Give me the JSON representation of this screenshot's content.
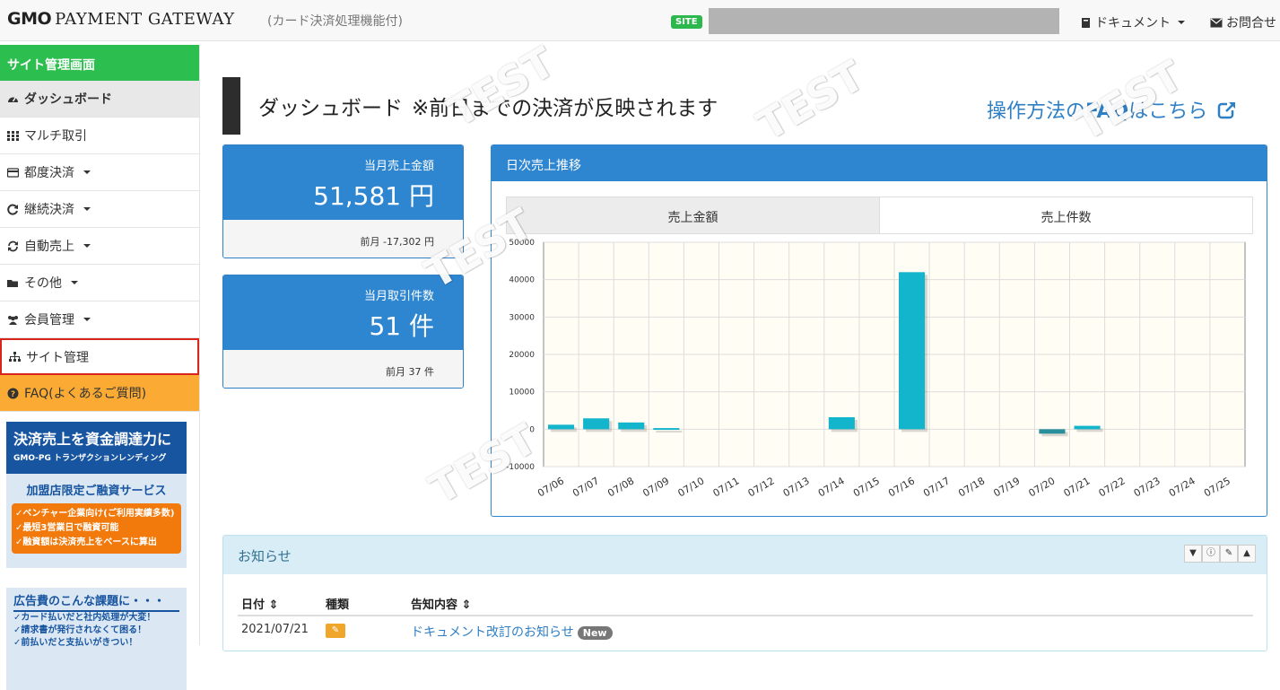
{
  "header": {
    "logo_gmo": "GMO",
    "logo_pg": "PAYMENT GATEWAY",
    "subtitle": "(カード決済処理機能付)",
    "site_badge": "SITE",
    "doc_label": "ドキュメント",
    "contact_label": "お問合せ"
  },
  "sidebar": {
    "title": "サイト管理画面",
    "items": [
      {
        "label": "ダッシュボード",
        "icon": "dashboard-icon"
      },
      {
        "label": "マルチ取引",
        "icon": "grid-icon"
      },
      {
        "label": "都度決済",
        "icon": "card-icon"
      },
      {
        "label": "継続決済",
        "icon": "repeat-icon"
      },
      {
        "label": "自動売上",
        "icon": "refresh-icon"
      },
      {
        "label": "その他",
        "icon": "folder-icon"
      },
      {
        "label": "会員管理",
        "icon": "users-icon"
      },
      {
        "label": "サイト管理",
        "icon": "sitemap-icon"
      },
      {
        "label": "FAQ(よくあるご質問)",
        "icon": "question-icon"
      }
    ],
    "banner1": {
      "title": "決済売上を資金調達力に",
      "subtitle": "GMO-PG トランザクションレンディング",
      "headline": "加盟店限定ご融資サービス",
      "points": [
        "✓ベンチャー企業向け(ご利用実績多数)",
        "✓最短3営業日で融資可能",
        "✓融資額は決済売上をベースに算出"
      ]
    },
    "banner2": {
      "title": "広告費のこんな課題に・・・",
      "points": [
        "✓カード払いだと社内処理が大変！",
        "✓請求書が発行されなくて困る！",
        "✓前払いだと支払いがきつい！"
      ]
    }
  },
  "main": {
    "title": "ダッシュボード",
    "title_note": "※前日までの決済が反映されます",
    "faq_link_pre": "操作方法の",
    "faq_link_bold": "FAQ",
    "faq_link_post": "はこちら",
    "sales": {
      "label": "当月売上金額",
      "value": "51,581 円",
      "prev": "前月 -17,302 円"
    },
    "count": {
      "label": "当月取引件数",
      "value": "51 件",
      "prev": "前月 37 件"
    },
    "chart_panel_title": "日次売上推移",
    "tab_amount": "売上金額",
    "tab_count": "売上件数",
    "watermark": "TEST"
  },
  "chart_data": {
    "type": "bar",
    "categories": [
      "07/06",
      "07/07",
      "07/08",
      "07/09",
      "07/10",
      "07/11",
      "07/12",
      "07/13",
      "07/14",
      "07/15",
      "07/16",
      "07/17",
      "07/18",
      "07/19",
      "07/20",
      "07/21",
      "07/22",
      "07/23",
      "07/24",
      "07/25"
    ],
    "values": [
      1200,
      2900,
      1800,
      300,
      0,
      0,
      0,
      0,
      3200,
      0,
      42000,
      0,
      0,
      0,
      -1200,
      900,
      0,
      0,
      0,
      0
    ],
    "ylim": [
      -10000,
      50000
    ],
    "yticks": [
      50000,
      40000,
      30000,
      20000,
      10000,
      0,
      -10000
    ],
    "grid": true,
    "colors": {
      "positive": "#12b5cb",
      "negative": "#2a8f9c"
    }
  },
  "notice": {
    "title": "お知らせ",
    "col_date": "日付",
    "col_type": "種類",
    "col_content": "告知内容",
    "rows": [
      {
        "date": "2021/07/21",
        "content": "ドキュメント改訂のお知らせ",
        "badge": "New"
      }
    ]
  }
}
